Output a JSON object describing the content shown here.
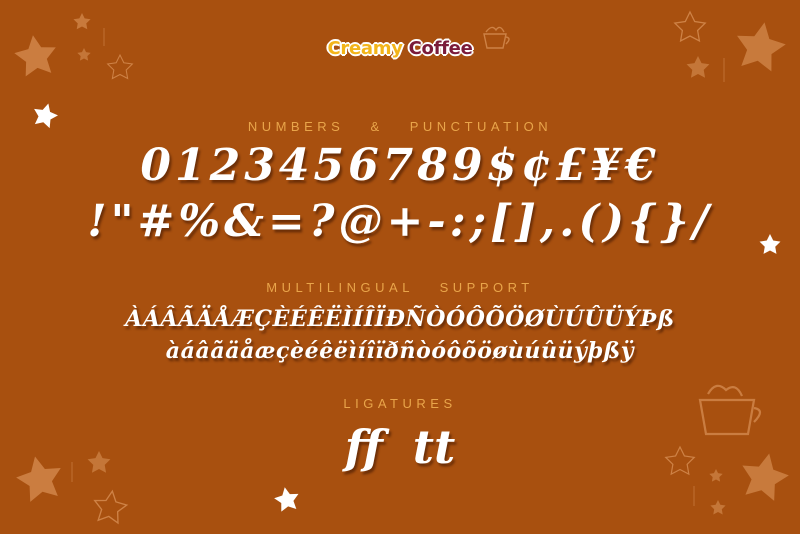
{
  "logo": {
    "word1": "Creamy",
    "word2": "Coffee"
  },
  "sections": {
    "numbers": {
      "heading": "NUMBERS & PUNCTUATION",
      "row1": "0123456789$¢£¥€",
      "row2": "!\"#%&=?@+-:;[],.(){}/"
    },
    "multilingual": {
      "heading": "MULTILINGUAL SUPPORT",
      "upper": "ÀÁÂÃÄÅÆÇÈÉÊËÌÍÎÏÐÑÒÓÔÕÖØÙÚÛÜÝÞß",
      "lower": "àáâãäåæçèéêëìíîïðñòóôõöøùúûüýþßÿ"
    },
    "ligatures": {
      "heading": "LIGATURES",
      "glyphs": "ff tt"
    }
  },
  "colors": {
    "background": "#A8500F",
    "heading": "#E9A54A",
    "glyph": "#FFFFFF",
    "logo_primary": "#F3B51A",
    "logo_secondary": "#7A1B3A"
  },
  "icons": [
    "star-icon",
    "coffee-cup-icon"
  ]
}
